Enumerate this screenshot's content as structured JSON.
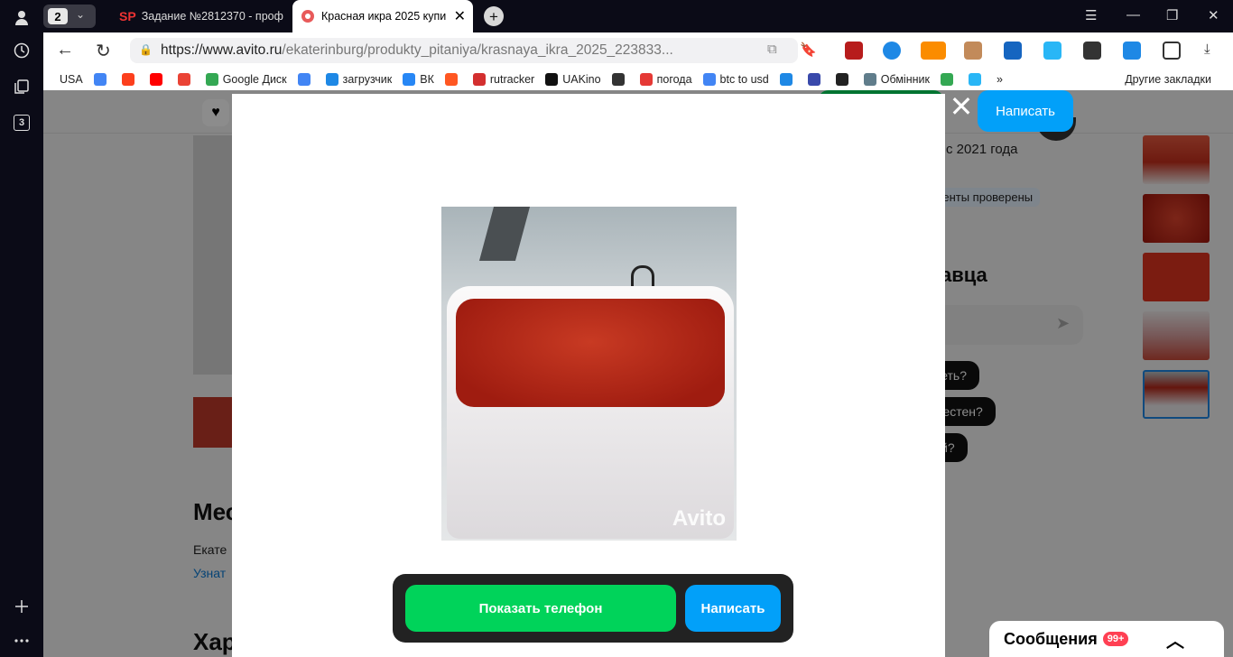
{
  "browser": {
    "tab_count": "2",
    "tabs": [
      {
        "favicon": "SP",
        "title": "Задание №2812370 - проф"
      },
      {
        "title": "Красная икра 2025 купи",
        "close": "✕"
      }
    ],
    "new_tab": "+",
    "url_host": "https://www.avito.ru",
    "url_path": "/ekaterinburg/produkty_pitaniya/krasnaya_ikra_2025_223833...",
    "sidebar_badge": "3",
    "bookmarks": [
      {
        "label": "USA",
        "icon_color": "#ffffff"
      },
      {
        "label": "",
        "icon_color": "#4285f4"
      },
      {
        "label": "",
        "icon_color": "#fc3f1d"
      },
      {
        "label": "",
        "icon_color": "#ff0000"
      },
      {
        "label": "",
        "icon_color": "#ea4335"
      },
      {
        "label": "Google Диск",
        "icon_color": "#34a853"
      },
      {
        "label": "",
        "icon_color": "#4285f4"
      },
      {
        "label": "загрузчик",
        "icon_color": "#1e88e5"
      },
      {
        "label": "ВК",
        "icon_color": "#2787f5"
      },
      {
        "label": "",
        "icon_color": "#ff5722"
      },
      {
        "label": "rutracker",
        "icon_color": "#d32f2f"
      },
      {
        "label": "UAKino",
        "icon_color": "#111111"
      },
      {
        "label": "",
        "icon_color": "#333333"
      },
      {
        "label": "погода",
        "icon_color": "#e53935"
      },
      {
        "label": "btc to usd",
        "icon_color": "#4285f4"
      },
      {
        "label": "",
        "icon_color": "#1e88e5"
      },
      {
        "label": "",
        "icon_color": "#3949ab"
      },
      {
        "label": "",
        "icon_color": "#222222"
      },
      {
        "label": "Обмінник",
        "icon_color": "#607d8b"
      },
      {
        "label": "",
        "icon_color": "#34a853"
      },
      {
        "label": "",
        "icon_color": "#29b6f6"
      }
    ],
    "more_bookmarks": "»",
    "other_bookmarks": "Другие закладки"
  },
  "page": {
    "bg_heading": "Мес",
    "bg_city": "Екате",
    "bg_link": "Узнат",
    "bg_heading2": "Хар",
    "seller_since": "с 2021 года",
    "docs_badge": "окументы проверены",
    "seller_heading": "давца",
    "quick_q1": "треть?",
    "quick_q2": "уместен?",
    "quick_q3": "кой?",
    "top_write_label": "Написать"
  },
  "modal": {
    "watermark": "Avito",
    "close_glyph": "✕",
    "show_phone_label": "Показать телефон",
    "write_label": "Написать"
  },
  "messages": {
    "label": "Сообщения",
    "count": "99+"
  }
}
